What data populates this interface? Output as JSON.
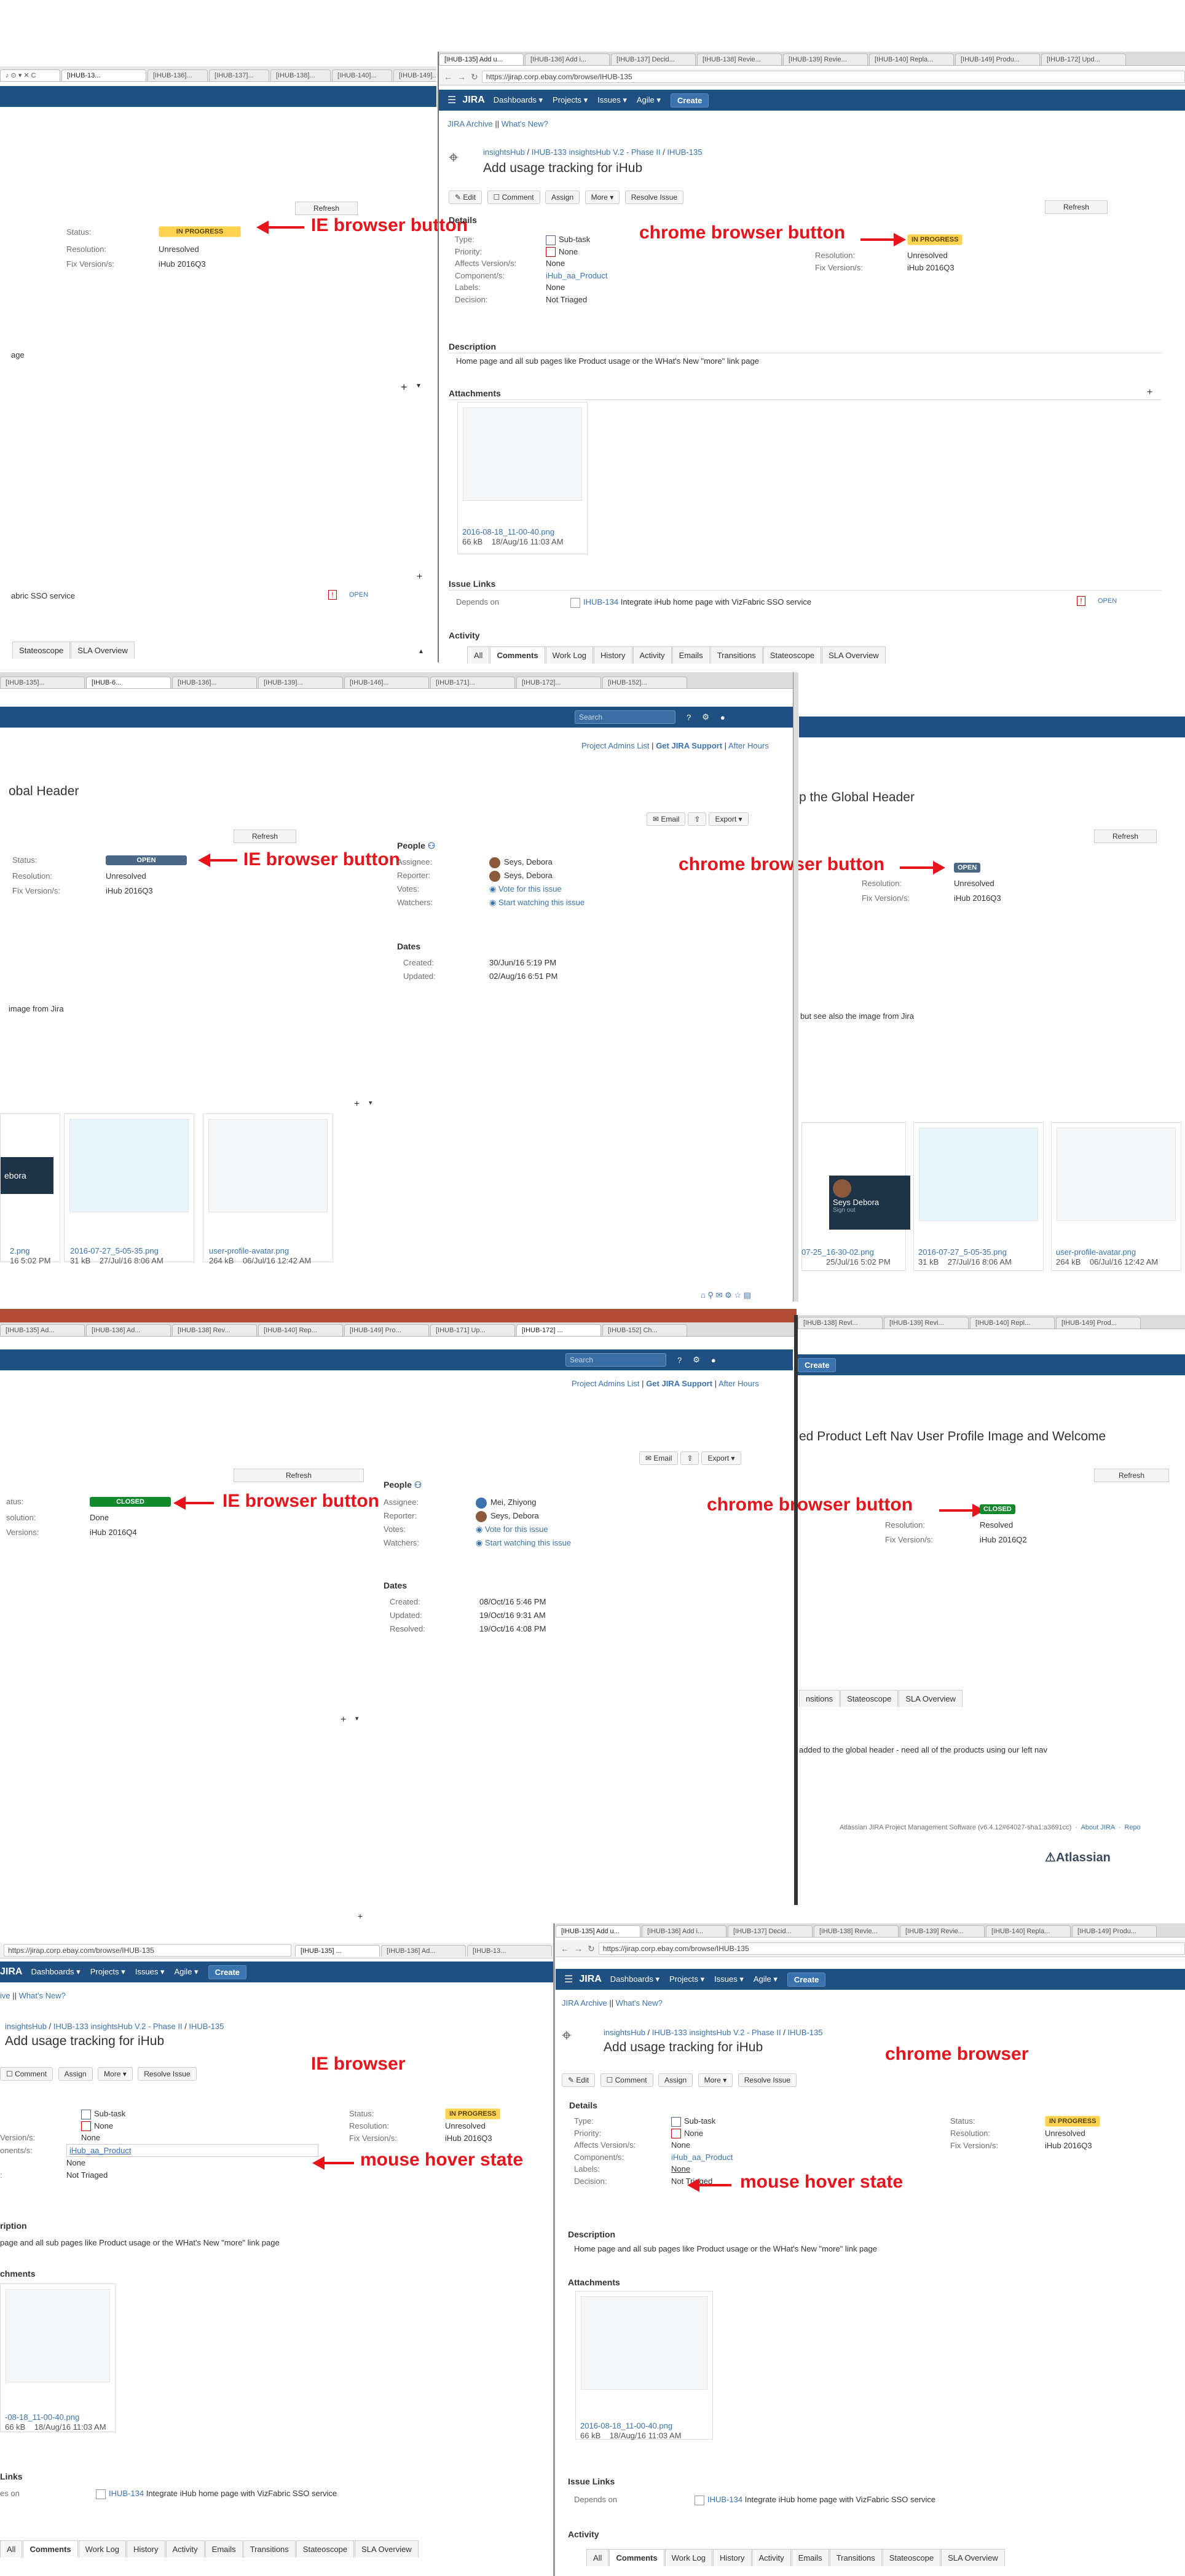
{
  "tabs_top": [
    "[IHUB-135] Add u...",
    "[IHUB-136] Add i...",
    "[IHUB-137] Decid...",
    "[IHUB-138] Revie...",
    "[IHUB-139] Revie...",
    "[IHUB-140] Repla...",
    "[IHUB-149] Produ...",
    "[IHUB-172] Upd..."
  ],
  "tabs_ie_top": [
    "[IHUB-13...",
    "[IHUB-136]...",
    "[IHUB-137]...",
    "[IHUB-138]...",
    "[IHUB-140]...",
    "[IHUB-149]..."
  ],
  "url": "https://jirap.corp.ebay.com/browse/IHUB-135",
  "url_ie": "https://jirap.corp.ebay.com/browse/IHUB-135",
  "header": {
    "logo": "JIRA",
    "menus": [
      "Dashboards ▾",
      "Projects ▾",
      "Issues ▾",
      "Agile ▾"
    ],
    "create": "Create",
    "search_placeholder": "Search"
  },
  "subnav": {
    "archive": "JIRA Archive",
    "whats_new": "What's New?",
    "sep": "||"
  },
  "subnav2": {
    "admins": "Project Admins List",
    "support": "Get JIRA Support",
    "after": "After Hours",
    "sep": "|"
  },
  "issue1": {
    "breadcrumb": [
      "insightsHub",
      "IHUB-133 insightsHub V.2 - Phase II",
      "IHUB-135"
    ],
    "title": "Add usage tracking for iHub",
    "buttons": [
      "Edit",
      "Comment",
      "Assign",
      "More ▾",
      "Resolve Issue"
    ],
    "refresh": "Refresh",
    "details_title": "Details",
    "fields": [
      {
        "label": "Type:",
        "value": "Sub-task"
      },
      {
        "label": "Priority:",
        "value": "None"
      },
      {
        "label": "Affects Version/s:",
        "value": "None"
      },
      {
        "label": "Component/s:",
        "value": "iHub_aa_Product"
      },
      {
        "label": "Labels:",
        "value": "None"
      },
      {
        "label": "Decision:",
        "value": "Not Triaged"
      }
    ],
    "status_label": "Status:",
    "status_value": "IN PROGRESS",
    "resolution_label": "Resolution:",
    "resolution_value": "Unresolved",
    "fixver_label": "Fix Version/s:",
    "fixver_value": "iHub 2016Q3",
    "description_title": "Description",
    "description": "Home page and all sub pages like Product usage or the WHat's New \"more\" link page",
    "attachments_title": "Attachments",
    "attachment_name": "2016-08-18_11-00-40.png",
    "attachment_size": "66 kB",
    "attachment_date": "18/Aug/16 11:03 AM",
    "links_title": "Issue Links",
    "depends_label": "Depends on",
    "depends_key": "IHUB-134",
    "depends_text": "Integrate iHub home page with VizFabric SSO service",
    "depends_status": "OPEN",
    "activity_title": "Activity",
    "activity_tabs": [
      "All",
      "Comments",
      "Work Log",
      "History",
      "Activity",
      "Emails",
      "Transitions",
      "Stateoscope",
      "SLA Overview"
    ]
  },
  "ie_left1": {
    "status_label": "Status:",
    "status_value": "IN PROGRESS",
    "resolution_label": "Resolution:",
    "resolution_value": "Unresolved",
    "fixver_label": "Fix Version/s:",
    "fixver_value": "iHub 2016Q3",
    "desc_fragment": "age",
    "links_fragment": "abric SSO service",
    "links_status": "OPEN",
    "tabs": [
      "Stateoscope",
      "SLA Overview"
    ],
    "refresh": "Refresh"
  },
  "annotations": {
    "ie_button": "IE browser button",
    "chrome_button": "chrome browser button",
    "ie_browser": "IE browser",
    "chrome_browser": "chrome browser",
    "hover": "mouse hover state"
  },
  "issue2": {
    "title_left": "obal Header",
    "title_right": "p the Global Header",
    "email": "Email",
    "export": "Export ▾",
    "refresh": "Refresh",
    "status_label": "Status:",
    "status_value": "OPEN",
    "resolution_label": "Resolution:",
    "resolution_value": "Unresolved",
    "fixver_label": "Fix Version/s:",
    "fixver_value": "iHub 2016Q3",
    "people_title": "People",
    "assignee_label": "Assignee:",
    "assignee": "Seys, Debora",
    "reporter_label": "Reporter:",
    "reporter": "Seys, Debora",
    "votes_label": "Votes:",
    "votes": "Vote for this issue",
    "watchers_label": "Watchers:",
    "watchers": "Start watching this issue",
    "dates_title": "Dates",
    "created_label": "Created:",
    "created": "30/Jun/16 5:19 PM",
    "updated_label": "Updated:",
    "updated": "02/Aug/16 6:51 PM",
    "desc_left": "image from Jira",
    "desc_right": "but see also the image from Jira",
    "attach1_name": "2.png",
    "attach1_meta": "16 5:02 PM",
    "attach2_name": "2016-07-27_5-05-35.png",
    "attach2_size": "31 kB",
    "attach2_date": "27/Jul/16 8:06 AM",
    "attach3_name": "user-profile-avatar.png",
    "attach3_size": "264 kB",
    "attach3_date": "06/Jul/16 12:42 AM",
    "attach_right1_name": "07-25_16-30-02.png",
    "attach_right1_date": "25/Jul/16 5:02 PM",
    "badge_name": "Seys Debora",
    "badge_sub": "Sign out",
    "debora_fragment": "ebora"
  },
  "issue3": {
    "title_right": "ed Product Left Nav User Profile Image and Welcome",
    "email": "Email",
    "export": "Export ▾",
    "refresh": "Refresh",
    "status_label": "atus:",
    "status_value": "CLOSED",
    "resolution_label": "solution:",
    "resolution_value": "Done",
    "fixver_label": "Versions:",
    "fixver_value": "iHub 2016Q4",
    "status_value_r": "CLOSED",
    "resolution_value_r": "Resolved",
    "fixver_value_r": "iHub 2016Q2",
    "people_title": "People",
    "assignee_label": "Assignee:",
    "assignee": "Mei, Zhiyong",
    "reporter_label": "Reporter:",
    "reporter": "Seys, Debora",
    "votes_label": "Votes:",
    "votes": "Vote for this issue",
    "watchers_label": "Watchers:",
    "watchers": "Start watching this issue",
    "dates_title": "Dates",
    "created_label": "Created:",
    "created": "08/Oct/16 5:46 PM",
    "updated_label": "Updated:",
    "updated": "19/Oct/16 9:31 AM",
    "resolved_label": "Resolved:",
    "resolved": "19/Oct/16 4:08 PM",
    "right_tabs": [
      "nsitions",
      "Stateoscope",
      "SLA Overview"
    ],
    "right_desc": "added to the global header - need all of the products using our left nav",
    "footer": "Atlassian JIRA Project Management Software (v6.4.12#64027-sha1:a3691cc)",
    "about": "About JIRA",
    "report": "Repo",
    "atlassian": "Atlassian"
  },
  "issue4": {
    "details_title": "Details",
    "status_label": "Status:",
    "status_value": "IN PROGRESS",
    "resolution_label": "Resolution:",
    "resolution_value": "Unresolved",
    "fixver_label": "Fix Version/s:",
    "fixver_value": "iHub 2016Q3",
    "left_labels": [
      "",
      "",
      "Version/s:",
      "onents/s:",
      "",
      ":"
    ],
    "left_values": [
      "Sub-task",
      "None",
      "None",
      "iHub_aa_Product",
      "None",
      "Not Triaged"
    ],
    "desc_left": "page and all sub pages like Product usage or the WHat's New \"more\" link page",
    "desc_title_left": "ription",
    "attach_title_left": "chments",
    "links_title_left": "Links",
    "depends_left": "es on",
    "attach_left_name": "-08-18_11-00-40.png",
    "attach_left_date": "18/Aug/16 11:03 AM",
    "tabs_left": [
      "All",
      "Comments",
      "Work Log",
      "History",
      "Activity",
      "Emails",
      "Transitions",
      "Stateoscope",
      "SLA Overview"
    ]
  }
}
